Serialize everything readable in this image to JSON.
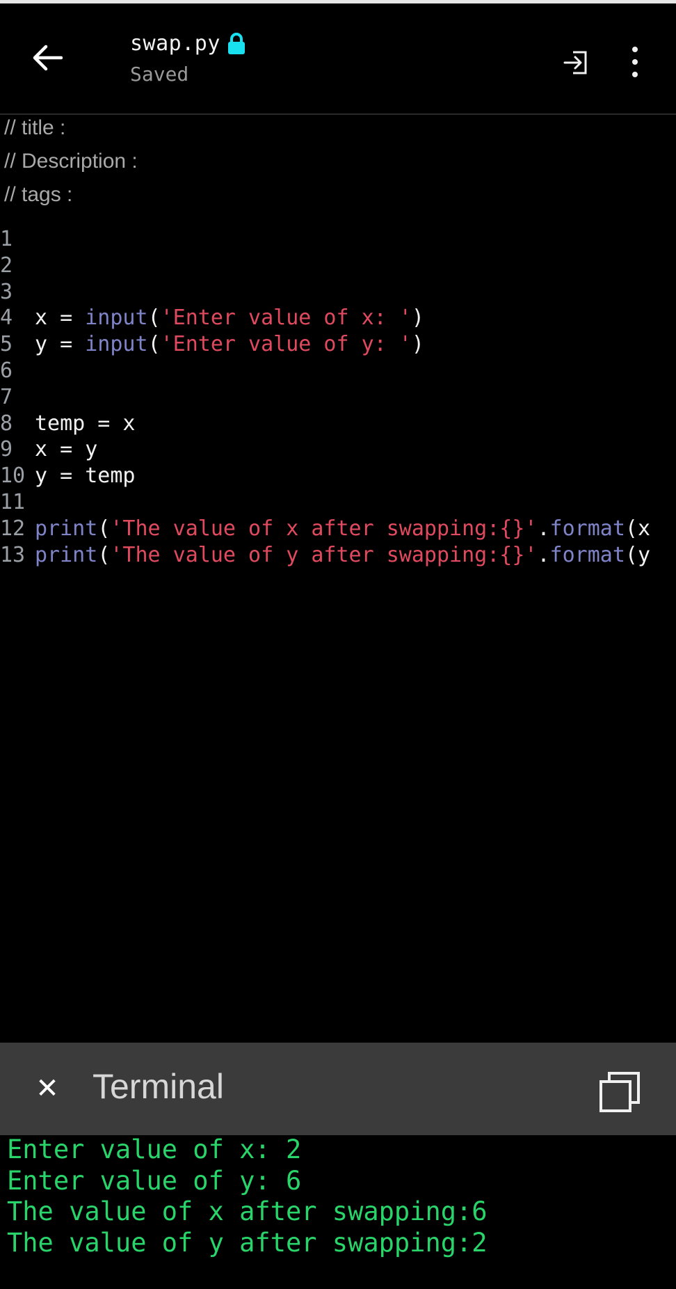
{
  "appbar": {
    "file_name": "swap.py",
    "status": "Saved",
    "icons": {
      "back": "back-arrow-icon",
      "lock": "lock-icon",
      "exit": "exit-icon",
      "menu": "more-vertical-icon"
    },
    "accent_color": "#19e0ef"
  },
  "meta": {
    "title": "// title :",
    "description": "// Description :",
    "tags": "// tags :"
  },
  "code": {
    "lines": [
      {
        "n": "1",
        "text": ""
      },
      {
        "n": "2",
        "text": ""
      },
      {
        "n": "3",
        "text": ""
      },
      {
        "n": "4",
        "text": "x = input('Enter value of x: ')"
      },
      {
        "n": "5",
        "text": "y = input('Enter value of y: ')"
      },
      {
        "n": "6",
        "text": ""
      },
      {
        "n": "7",
        "text": ""
      },
      {
        "n": "8",
        "text": "temp = x"
      },
      {
        "n": "9",
        "text": "x = y"
      },
      {
        "n": "10",
        "text": "y = temp"
      },
      {
        "n": "11",
        "text": ""
      },
      {
        "n": "12",
        "text": "print('The value of x after swapping:{}'.format(x"
      },
      {
        "n": "13",
        "text": "print('The value of y after swapping:{}'.format(y"
      }
    ]
  },
  "terminal": {
    "title": "Terminal",
    "close_icon": "close-icon",
    "copy_icon": "copy-icon",
    "output": [
      "Enter value of x: 2",
      "Enter value of y: 6",
      "The value of x after swapping:6",
      "The value of y after swapping:2"
    ]
  }
}
